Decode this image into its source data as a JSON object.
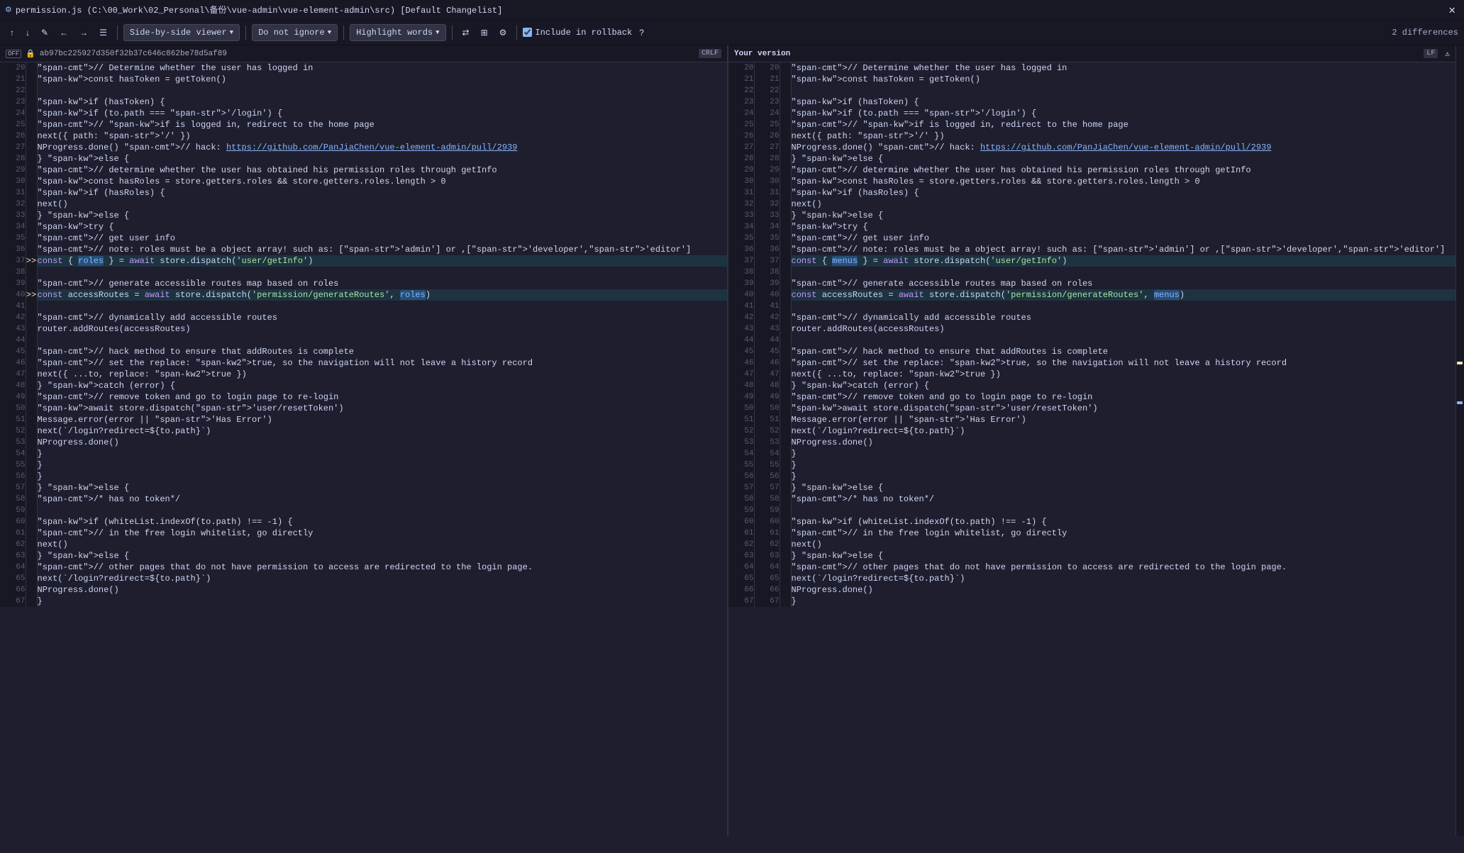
{
  "titlebar": {
    "title": "permission.js (C:\\00_Work\\02_Personal\\备份\\vue-admin\\vue-element-admin\\src) [Default Changelist]",
    "icon": "⚙"
  },
  "toolbar": {
    "up_arrow": "↑",
    "down_arrow": "↓",
    "edit_icon": "✎",
    "back": "←",
    "forward": "→",
    "menu_icon": "☰",
    "viewer_label": "Side-by-side viewer",
    "ignore_label": "Do not ignore",
    "highlight_label": "Highlight words",
    "filter_icon": "⇄",
    "grid_icon": "⊞",
    "gear_icon": "⚙",
    "include_rollback_label": "Include in rollback",
    "help_icon": "?",
    "differences_label": "2 differences"
  },
  "left_panel": {
    "hash": "ab97bc225927d350f32b37c646c862be78d5af89",
    "encoding": "CRLF",
    "lock": "🔒",
    "off_label": "OFF"
  },
  "right_panel": {
    "label": "Your version",
    "encoding": "LF",
    "warning": "⚠"
  },
  "lines": [
    {
      "ln_left": "20",
      "ln_right": "20",
      "left_code": "// Determine whether the user has logged in",
      "right_code": "// Determine whether the user has logged in",
      "type": "normal"
    },
    {
      "ln_left": "21",
      "ln_right": "21",
      "left_code": "    const hasToken = getToken()",
      "right_code": "    const hasToken = getToken()",
      "type": "normal"
    },
    {
      "ln_left": "22",
      "ln_right": "22",
      "left_code": "",
      "right_code": "",
      "type": "normal"
    },
    {
      "ln_left": "23",
      "ln_right": "23",
      "left_code": "    if (hasToken) {",
      "right_code": "    if (hasToken) {",
      "type": "normal"
    },
    {
      "ln_left": "24",
      "ln_right": "24",
      "left_code": "      if (to.path === '/login') {",
      "right_code": "      if (to.path === '/login') {",
      "type": "normal"
    },
    {
      "ln_left": "25",
      "ln_right": "25",
      "left_code": "        // if is logged in, redirect to the home page",
      "right_code": "        // if is logged in, redirect to the home page",
      "type": "normal"
    },
    {
      "ln_left": "26",
      "ln_right": "26",
      "left_code": "        next({ path: '/' })",
      "right_code": "        next({ path: '/' })",
      "type": "normal"
    },
    {
      "ln_left": "27",
      "ln_right": "27",
      "left_code": "        NProgress.done() // hack: https://github.com/PanJiaChen/vue-element-admin/pull/2939",
      "right_code": "        NProgress.done() // hack: https://github.com/PanJiaChen/vue-element-admin/pull/2939",
      "type": "normal"
    },
    {
      "ln_left": "28",
      "ln_right": "28",
      "left_code": "      } else {",
      "right_code": "      } else {",
      "type": "normal"
    },
    {
      "ln_left": "29",
      "ln_right": "29",
      "left_code": "        // determine whether the user has obtained his permission roles through getInfo",
      "right_code": "        // determine whether the user has obtained his permission roles through getInfo",
      "type": "normal"
    },
    {
      "ln_left": "30",
      "ln_right": "30",
      "left_code": "        const hasRoles = store.getters.roles && store.getters.roles.length > 0",
      "right_code": "        const hasRoles = store.getters.roles && store.getters.roles.length > 0",
      "type": "normal"
    },
    {
      "ln_left": "31",
      "ln_right": "31",
      "left_code": "        if (hasRoles) {",
      "right_code": "        if (hasRoles) {",
      "type": "normal"
    },
    {
      "ln_left": "32",
      "ln_right": "32",
      "left_code": "          next()",
      "right_code": "          next()",
      "type": "normal"
    },
    {
      "ln_left": "33",
      "ln_right": "33",
      "left_code": "        } else {",
      "right_code": "        } else {",
      "type": "normal"
    },
    {
      "ln_left": "34",
      "ln_right": "34",
      "left_code": "          try {",
      "right_code": "          try {",
      "type": "normal"
    },
    {
      "ln_left": "35",
      "ln_right": "35",
      "left_code": "            // get user info",
      "right_code": "            // get user info",
      "type": "normal"
    },
    {
      "ln_left": "36",
      "ln_right": "36",
      "left_code": "            // note: roles must be a object array! such as: ['admin'] or ,['developer','editor']",
      "right_code": "            // note: roles must be a object array! such as: ['admin'] or ,['developer','editor']",
      "type": "normal"
    },
    {
      "ln_left": "37",
      "ln_right": "37",
      "left_code_parts": [
        "            const { ",
        "roles",
        " } = await store.dispatch('user/getInfo')"
      ],
      "right_code_parts": [
        "            const { ",
        "menus",
        " } = await store.dispatch('user/getInfo')"
      ],
      "type": "changed",
      "marker": ">>"
    },
    {
      "ln_left": "38",
      "ln_right": "38",
      "left_code": "",
      "right_code": "",
      "type": "normal"
    },
    {
      "ln_left": "39",
      "ln_right": "39",
      "left_code": "            // generate accessible routes map based on roles",
      "right_code": "            // generate accessible routes map based on roles",
      "type": "normal"
    },
    {
      "ln_left": "40",
      "ln_right": "40",
      "left_code_parts": [
        "            const accessRoutes = await store.dispatch('permission/generateRoutes', ",
        "roles",
        ")"
      ],
      "right_code_parts": [
        "            const accessRoutes = await store.dispatch('permission/generateRoutes', ",
        "menus",
        ")"
      ],
      "type": "changed",
      "marker": ">>"
    },
    {
      "ln_left": "41",
      "ln_right": "41",
      "left_code": "",
      "right_code": "",
      "type": "normal"
    },
    {
      "ln_left": "42",
      "ln_right": "42",
      "left_code": "            // dynamically add accessible routes",
      "right_code": "            // dynamically add accessible routes",
      "type": "normal"
    },
    {
      "ln_left": "43",
      "ln_right": "43",
      "left_code": "            router.addRoutes(accessRoutes)",
      "right_code": "            router.addRoutes(accessRoutes)",
      "type": "normal"
    },
    {
      "ln_left": "44",
      "ln_right": "44",
      "left_code": "",
      "right_code": "",
      "type": "normal"
    },
    {
      "ln_left": "45",
      "ln_right": "45",
      "left_code": "            // hack method to ensure that addRoutes is complete",
      "right_code": "            // hack method to ensure that addRoutes is complete",
      "type": "normal"
    },
    {
      "ln_left": "46",
      "ln_right": "46",
      "left_code": "            // set the replace: true, so the navigation will not leave a history record",
      "right_code": "            // set the replace: true, so the navigation will not leave a history record",
      "type": "normal"
    },
    {
      "ln_left": "47",
      "ln_right": "47",
      "left_code": "            next({ ...to, replace: true })",
      "right_code": "            next({ ...to, replace: true })",
      "type": "normal"
    },
    {
      "ln_left": "48",
      "ln_right": "48",
      "left_code": "          } catch (error) {",
      "right_code": "          } catch (error) {",
      "type": "normal"
    },
    {
      "ln_left": "49",
      "ln_right": "49",
      "left_code": "            // remove token and go to login page to re-login",
      "right_code": "            // remove token and go to login page to re-login",
      "type": "normal"
    },
    {
      "ln_left": "50",
      "ln_right": "50",
      "left_code": "            await store.dispatch('user/resetToken')",
      "right_code": "            await store.dispatch('user/resetToken')",
      "type": "normal"
    },
    {
      "ln_left": "51",
      "ln_right": "51",
      "left_code": "            Message.error(error || 'Has Error')",
      "right_code": "            Message.error(error || 'Has Error')",
      "type": "normal"
    },
    {
      "ln_left": "52",
      "ln_right": "52",
      "left_code": "            next(`/login?redirect=${to.path}`)",
      "right_code": "            next(`/login?redirect=${to.path}`)",
      "type": "normal"
    },
    {
      "ln_left": "53",
      "ln_right": "53",
      "left_code": "            NProgress.done()",
      "right_code": "            NProgress.done()",
      "type": "normal"
    },
    {
      "ln_left": "54",
      "ln_right": "54",
      "left_code": "          }",
      "right_code": "          }",
      "type": "normal"
    },
    {
      "ln_left": "55",
      "ln_right": "55",
      "left_code": "        }",
      "right_code": "        }",
      "type": "normal"
    },
    {
      "ln_left": "56",
      "ln_right": "56",
      "left_code": "      }",
      "right_code": "      }",
      "type": "normal"
    },
    {
      "ln_left": "57",
      "ln_right": "57",
      "left_code": "    } else {",
      "right_code": "    } else {",
      "type": "normal"
    },
    {
      "ln_left": "58",
      "ln_right": "58",
      "left_code": "      /* has no token*/",
      "right_code": "      /* has no token*/",
      "type": "normal"
    },
    {
      "ln_left": "59",
      "ln_right": "59",
      "left_code": "",
      "right_code": "",
      "type": "normal"
    },
    {
      "ln_left": "60",
      "ln_right": "60",
      "left_code": "      if (whiteList.indexOf(to.path) !== -1) {",
      "right_code": "      if (whiteList.indexOf(to.path) !== -1) {",
      "type": "normal"
    },
    {
      "ln_left": "61",
      "ln_right": "61",
      "left_code": "        // in the free login whitelist, go directly",
      "right_code": "        // in the free login whitelist, go directly",
      "type": "normal"
    },
    {
      "ln_left": "62",
      "ln_right": "62",
      "left_code": "        next()",
      "right_code": "        next()",
      "type": "normal"
    },
    {
      "ln_left": "63",
      "ln_right": "63",
      "left_code": "      } else {",
      "right_code": "      } else {",
      "type": "normal"
    },
    {
      "ln_left": "64",
      "ln_right": "64",
      "left_code": "        // other pages that do not have permission to access are redirected to the login page.",
      "right_code": "        // other pages that do not have permission to access are redirected to the login page.",
      "type": "normal"
    },
    {
      "ln_left": "65",
      "ln_right": "65",
      "left_code": "        next(`/login?redirect=${to.path}`)",
      "right_code": "        next(`/login?redirect=${to.path}`)",
      "type": "normal"
    },
    {
      "ln_left": "66",
      "ln_right": "66",
      "left_code": "        NProgress.done()",
      "right_code": "        NProgress.done()",
      "type": "normal"
    },
    {
      "ln_left": "67",
      "ln_right": "67",
      "left_code": "      }",
      "right_code": "      }",
      "type": "normal"
    }
  ]
}
